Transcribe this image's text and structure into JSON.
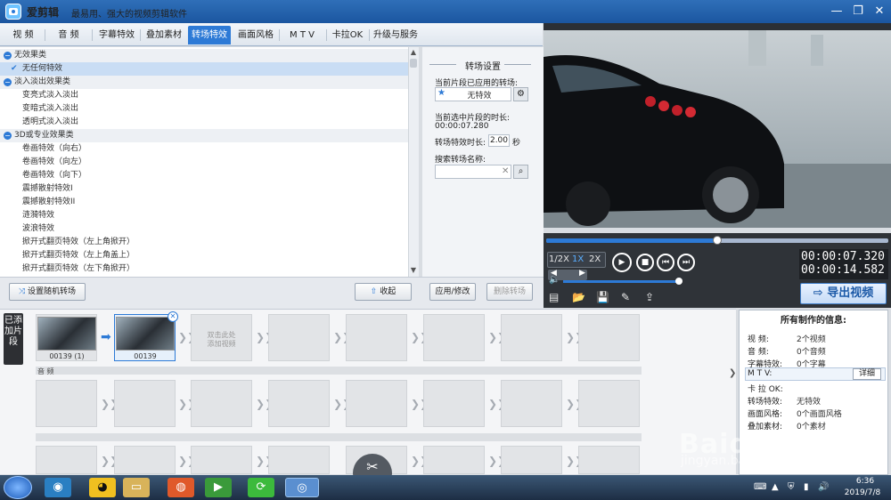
{
  "window": {
    "app_name": "爱剪辑",
    "slogan": "最易用、强大的视频剪辑软件",
    "controls": [
      "—",
      "❐",
      "✕"
    ]
  },
  "tabs": [
    {
      "label": "视  频",
      "active": false
    },
    {
      "label": "音  频",
      "active": false
    },
    {
      "label": "字幕特效",
      "active": false
    },
    {
      "label": "叠加素材",
      "active": false
    },
    {
      "label": "转场特效",
      "active": true
    },
    {
      "label": "画面风格",
      "active": false
    },
    {
      "label": "M T V",
      "active": false
    },
    {
      "label": "卡拉OK",
      "active": false
    },
    {
      "label": "升级与服务",
      "active": false
    }
  ],
  "effects": {
    "categories": [
      "无效果类",
      "淡入淡出效果类",
      "3D或专业效果类"
    ],
    "items": [
      {
        "label": "无效果类",
        "type": "cat"
      },
      {
        "label": "无任何特效",
        "type": "item",
        "selected": true
      },
      {
        "label": "淡入淡出效果类",
        "type": "cat"
      },
      {
        "label": "变亮式淡入淡出",
        "type": "item"
      },
      {
        "label": "变暗式淡入淡出",
        "type": "item"
      },
      {
        "label": "透明式淡入淡出",
        "type": "item"
      },
      {
        "label": "3D或专业效果类",
        "type": "cat"
      },
      {
        "label": "卷画特效（向右）",
        "type": "item"
      },
      {
        "label": "卷画特效（向左）",
        "type": "item"
      },
      {
        "label": "卷画特效（向下）",
        "type": "item"
      },
      {
        "label": "震撼散射特效I",
        "type": "item"
      },
      {
        "label": "震撼散射特效II",
        "type": "item"
      },
      {
        "label": "涟漪特效",
        "type": "item"
      },
      {
        "label": "波浪特效",
        "type": "item"
      },
      {
        "label": "掀开式翻页特效（左上角掀开）",
        "type": "item"
      },
      {
        "label": "掀开式翻页特效（左上角盖上）",
        "type": "item"
      },
      {
        "label": "掀开式翻页特效（左下角掀开）",
        "type": "item"
      }
    ],
    "random_button": "设置随机转场",
    "collapse_button": "收起"
  },
  "settings": {
    "title": "转场设置",
    "applied_label": "当前片段已应用的转场:",
    "applied_value": "无特效",
    "duration_label": "当前选中片段的时长:",
    "duration_value": "00:00:07.280",
    "effect_duration_label": "转场特效时长:",
    "effect_duration_value": "2.00",
    "effect_duration_unit": "秒",
    "search_label": "搜索转场名称:",
    "search_value": "",
    "apply_button": "应用/修改",
    "delete_button": "删除转场"
  },
  "player": {
    "progress_fraction": 0.5,
    "speeds": [
      "1/2X",
      "1X",
      "2X"
    ],
    "active_speed": "1X",
    "current_time": "00:00:07.320",
    "total_time": "00:00:14.582",
    "volume_fraction": 0.97,
    "export_button": "导出视频",
    "icons": [
      "play-icon",
      "stop-icon",
      "prev-icon",
      "next-icon",
      "volume-icon",
      "new-project-icon",
      "open-folder-icon",
      "save-icon",
      "save-as-icon",
      "share-icon"
    ]
  },
  "timeline": {
    "side_label": "已添加片段",
    "clips": [
      {
        "label": "00139 (1)"
      },
      {
        "label": "00139"
      }
    ],
    "add_hint_line1": "双击此处",
    "add_hint_line2": "添加视频",
    "audio_label": "音 频"
  },
  "info": {
    "title": "所有制作的信息:",
    "rows": [
      {
        "label": "视    频:",
        "value": "2个视频"
      },
      {
        "label": "音    频:",
        "value": "0个音频"
      },
      {
        "label": "字幕特效:",
        "value": "0个字幕"
      },
      {
        "label": "M  T  V:",
        "value": ""
      },
      {
        "label": "卡 拉 OK:",
        "value": ""
      },
      {
        "label": "转场特效:",
        "value": "无特效"
      },
      {
        "label": "画面风格:",
        "value": "0个画面风格"
      },
      {
        "label": "叠加素材:",
        "value": "0个素材"
      }
    ],
    "detail_button": "详细"
  },
  "taskbar": {
    "time": "6:36",
    "date": "2019/7/8"
  },
  "watermark": {
    "line1": "Baidu 经验",
    "line2": "jingyan.baidu.com"
  }
}
